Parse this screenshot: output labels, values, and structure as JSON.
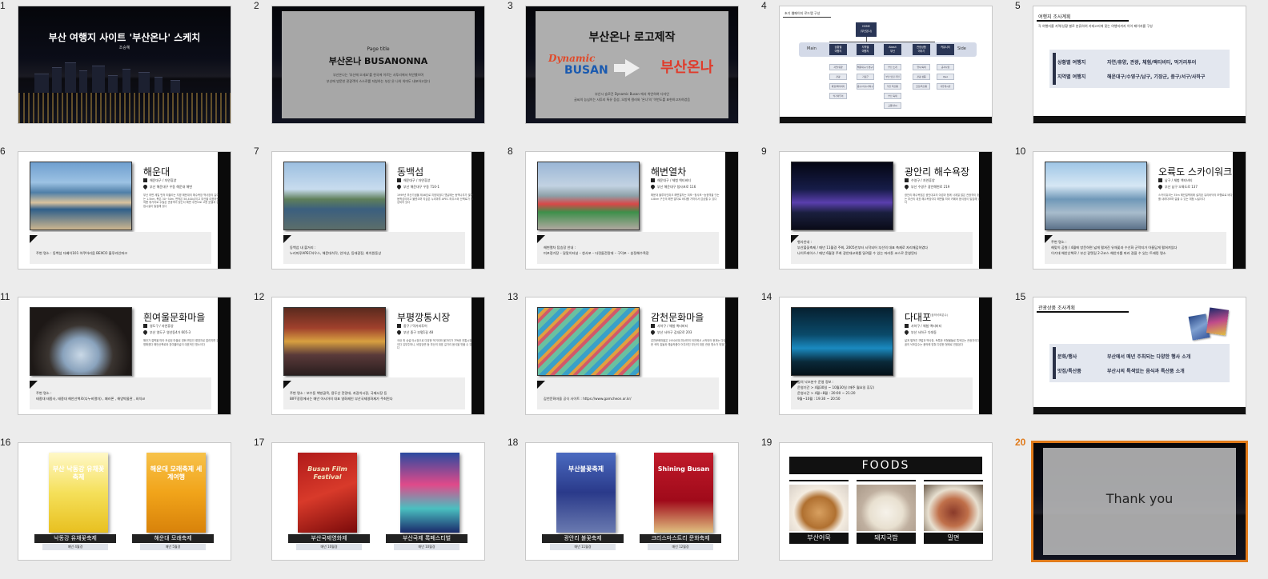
{
  "slides": [
    {
      "n": "1",
      "title": "부산 여행지 사이트 '부산온나' 스케치",
      "author": "조승혜"
    },
    {
      "n": "2",
      "small": "Page title",
      "title": "부산온나 BUSANONNA",
      "desc": "부산온나는 '부산에 오세요'를 한국에 이르는 사투리에서 착안했으며\n부산에 방문한 관광객이 스스로를 지칭하는 부산 온 나의 의미도 내포하고있다"
    },
    {
      "n": "3",
      "title": "부산온나 로고제작",
      "logo_left_1": "Dynamic",
      "logo_left_2": "BUSAN",
      "logo_right": "부산온나",
      "desc": "부산시 슬로건 Dynamic Busan 에서 착안하여 디자인\n글씨의 능넘이는 사투리 특유 음성, 오방색 컬러와 '온나'의 '이번도를 표현하고자하였음"
    },
    {
      "n": "4",
      "title": "초기 웹페이지 로드맵 구성",
      "home": "HOME\n(부산온나)",
      "main": "Main",
      "side": "Side"
    },
    {
      "n": "5",
      "title": "여행지 조사계획",
      "desc": "각 여행지를 지역/상황 별로 분류하여 카테고리에 맞는 여행지까지 이어 페이지를 구성",
      "row1_label": "상황별 여행지",
      "row1_value": "자연/휴양, 관광, 체험/액티비티, 먹거리투어",
      "row2_label": "지역별 여행지",
      "row2_value": "해운대구/수영구/남구, 기장군, 중구/서구/사하구"
    },
    {
      "n": "6",
      "title": "해운대",
      "meta1": "해운대구 / 자연휴양",
      "meta2": "부산 해운대구 우동 해운대 해변",
      "body": "부산 하면 제일 먼저 떠올리는 지명 해운대의 해수욕장 백사장의 길이는 1.5km, 폭은 30~50m, 면적은 58,400㎡이고 부산을 대표하는 여름 휴가지로 수많은 관광객이 찾는다 해변 주변으로 고층 호텔과 상업시설이 밀집해 있다",
      "note": "주변 명소 : 동백섬 더베이101 아쿠아리움 BEXCO 블루라인파크"
    },
    {
      "n": "7",
      "title": "동백섬",
      "meta1": "해운대구 / 자연휴양",
      "meta2": "부산 해운대구 우동 710-1",
      "body": "1999년 부산기념물 제46호로 지정되었다 옛날에는 동백나무가 많아 동백섬이라고 불렸으며 지금은 누리마루 APEC 하우스와 산책로가 조성되어 있다",
      "note": "동백섬 내 볼거리 :\n누리마루APEC하우스, 해운대석각, 인어상, 등대광장, 최치원동상"
    },
    {
      "n": "8",
      "title": "해변열차",
      "meta1": "해운대구 / 체험 액티비티",
      "meta2": "부산 해운대구 청사포로 116",
      "body": "해운대 블루라인파크 해변열차는 미포~청사포~송정역을 잇는 4.8km 구간의 해변 열차로 바다를 가까이서 감상할 수 있다",
      "note": "해변열차 탑승장 안내 :\n미포정거장 – 달맞이터널 – 청사포 – 다릿돌전망대 – 구덕포 – 송정해수욕장"
    },
    {
      "n": "9",
      "title": "광안리 해수욕장",
      "meta1": "수영구 / 자연휴양",
      "meta2": "부산 수영구 광안해변로 219",
      "body": "광안리 해수욕장은 광안대교의 야경과 함께 사계절 많은 관광객이 찾는 부산의 대표 해수욕장이다 해변을 따라 카페와 음식점이 밀집해 있다",
      "note": "행사안내 :\n부산불꽃축제 / 매년 11월경 주최, 2005년부터 시작되어 부산의 대표 축제로 자리매김하였다\n나이트레이스 / 매년 6월경 주최 광안대교위를 달려볼 수 있는 마라톤 코스로 운영된다"
    },
    {
      "n": "10",
      "title": "오륙도 스카이워크",
      "meta1": "남구 / 체험 액티비티",
      "meta2": "부산 남구 오륙도로 137",
      "body": "스카이워크는 35m 해안절벽위에 설치된 유리바닥의 보행로로 바다를 내려다보며 걸을 수 있는 체험 시설이다",
      "note": "주변 명소 :\n해맞이 공원 / 4월에 방문하면 넓게 펼쳐진 유채꽃과 수선화 군락지가 아름답게 펼쳐져있다\n이기대 해안산책로 / 부산 갈맷길 2-2코스 해안가를 따라 걸을 수 있는 트래킹 명소"
    },
    {
      "n": "11",
      "title": "흰여울문화마을",
      "meta1": "영도구 / 자연휴양",
      "meta2": "부산 영도구 영선동4가 605-3",
      "body": "해안가 절벽을 따라 조성된 마을로 영화 변호인 촬영지로 알려지며 유명해졌다 해안산책로와 흰여울터널이 대표적인 명소이다",
      "note": "주변 명소 :\n태종대 태종사, 태종대 해안산책로(다누비열차) , 패러론 , 해양박물관 , 와치코"
    },
    {
      "n": "12",
      "title": "부평깡통시장",
      "meta1": "중구 / 먹거리투어",
      "meta2": "부산 중구 부평1길 48",
      "body": "국내 첫 상설 야시장으로 다양한 먹거리와 볼거리가 가득한 전통시장이다 유부주머니, 비빔당면 등 부산의 대표 길거리 음식을 맛볼 수 있다",
      "note": "주변 명소 : 보수동 책방골목, 용두산 전망대, 자갈치시장, 국제시장 등\nBIFF광장에서는 매년 아시아의 대표 영화제인 부산국제영화제가 주최된다"
    },
    {
      "n": "13",
      "title": "감천문화마을",
      "meta1": "사하구 / 체험 액티비티",
      "meta2": "부산 사하구 감내2로 203",
      "body": "감천문화마을은 1950년대 피난민의 터전에서 시작되어 현재는 다양한 색의 집들과 예술작품이 어우러진 부산의 대표 관광 명소가 되었다",
      "note": "감천문화마을 공식 사이트 : https://www.gamcheon.or.kr/"
    },
    {
      "n": "14",
      "title": "다대포",
      "title_small": "(꿈의낙조분수)",
      "meta1": "사하구 / 체험 액티비티",
      "meta2": "부산 사하구 다대동",
      "body": "넓게 펼쳐진 갯벌과 백사장, 독특한 조형물들로 특색있는 관광지이다 꿈의 낙조분수는 음악에 맞춰 다양한 형태로 연출된다",
      "note": "꿈의 낙조분수 운영 정보 :\n운영기간 > 4월30일 ~ 10월30일 (매주 월요일 휴무)\n운영시간 > 4월~8월 : 20:00 ~ 21:20\n9월~10월 : 19:30 ~ 20:50"
    },
    {
      "n": "15",
      "title": "관광상품 조사계획",
      "row1_label": "문화/행사",
      "row1_value": "부산에서 매년 주최되는 다양한 행사 소개",
      "row2_label": "맛집/특산품",
      "row2_value": "부산시의 특색있는 음식과 특산품 소개"
    },
    {
      "n": "16",
      "cap1": "낙동강 유채꽃축제",
      "sub1": "매년 4월경",
      "cap2": "해운대 모래축제",
      "sub2": "매년 5월경",
      "p1": "부산 낙동강 유채꽃축제",
      "p2": "해운대 모래축제 세계여행"
    },
    {
      "n": "17",
      "cap1": "부산국제영화제",
      "sub1": "매년 10월경",
      "cap2": "부산국제 록페스티벌",
      "sub2": "매년 10월경",
      "p1": "Busan Film Festival"
    },
    {
      "n": "18",
      "cap1": "광안리 불꽃축제",
      "sub1": "매년 11월경",
      "cap2": "크리스마스트리 문화축제",
      "sub2": "매년 12월경",
      "p1": "부산불꽃축제",
      "p2": "Shining Busan"
    },
    {
      "n": "19",
      "title": "FOODS",
      "f1": "부산어묵",
      "f2": "돼지국밥",
      "f3": "밀면"
    },
    {
      "n": "20",
      "title": "Thank you"
    }
  ],
  "sitemap": {
    "level1": [
      "상황별\n여행지",
      "지역별\n여행지",
      "About\n부산",
      "관광상품\n이야기",
      "커뮤니티"
    ],
    "col1": [
      "자연/휴양",
      "관광",
      "체험/액티비티",
      "먹거리투어"
    ],
    "col2": [
      "해운대구/수영구/남구",
      "기장군",
      "중구/서구/사하구"
    ],
    "col3": [
      "부산 소개",
      "부산 맛집 추천",
      "부산 특산품",
      "부산 축제",
      "교통/날씨"
    ],
    "col4": [
      "행사/축제",
      "관광 상품",
      "맛집/특산품"
    ],
    "col5": [
      "공지사항",
      "Q&A",
      "자유게시판"
    ]
  },
  "selected_slide": "20",
  "colors": {
    "accent": "#e07a1a",
    "navy": "#2a3656",
    "panel": "#e3e7ef"
  }
}
